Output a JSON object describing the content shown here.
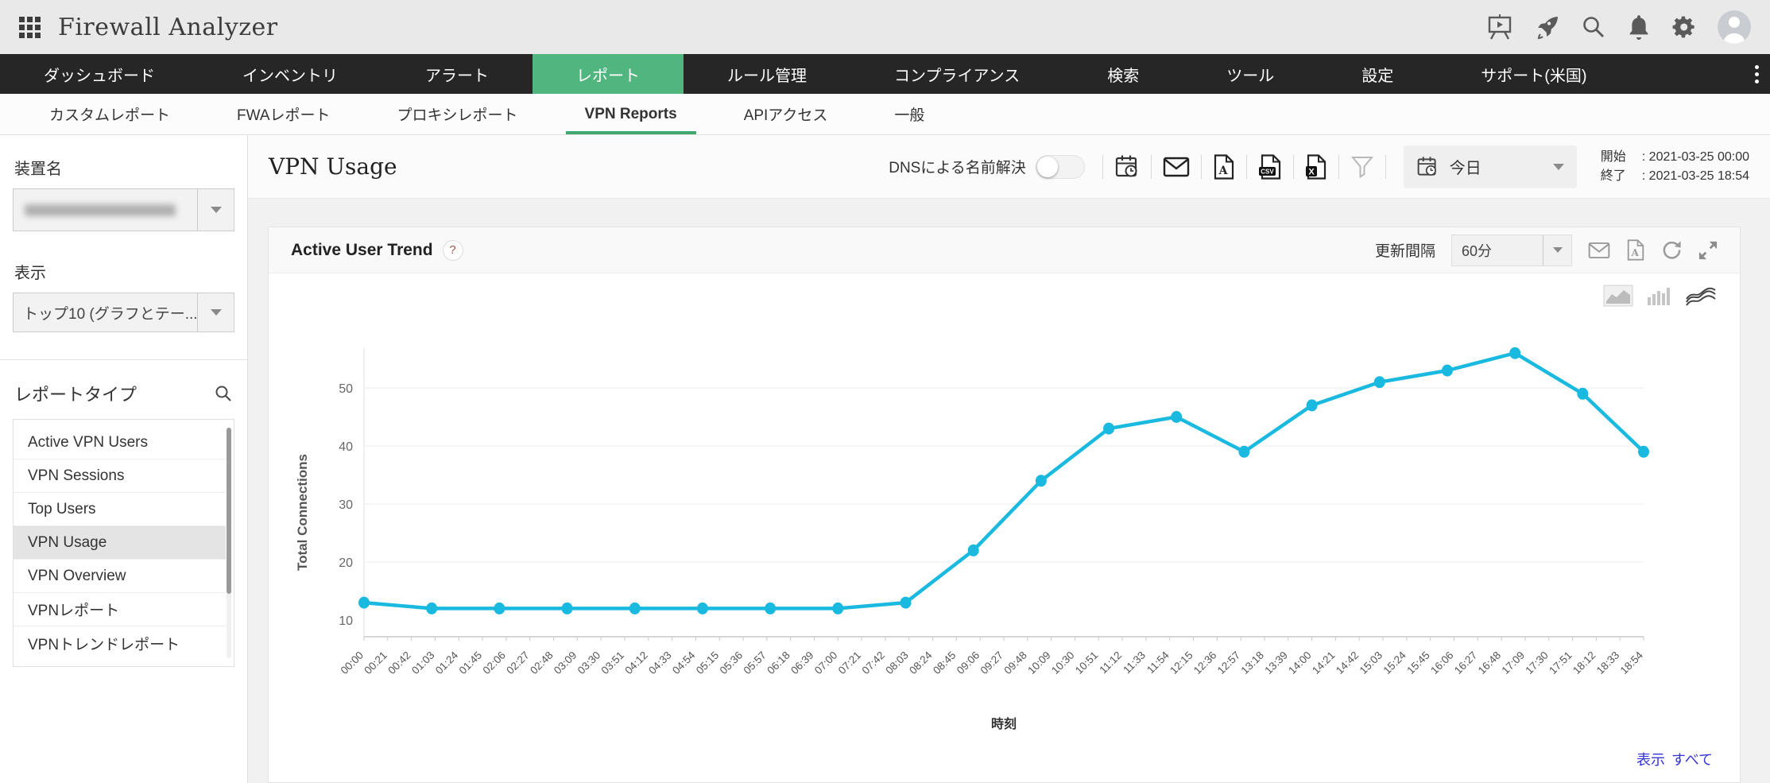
{
  "colors": {
    "accent_green": "#50b57e",
    "active_tab_underline": "#3ea86f",
    "nav_bg": "#262626",
    "line_cyan": "#1ab9e0",
    "link_blue": "#3434d6",
    "selected_row_bg": "#e4e4e4"
  },
  "header": {
    "title": "Firewall Analyzer",
    "icons": [
      "apps-grid-icon",
      "presentation-icon",
      "rocket-icon",
      "search-icon",
      "bell-icon",
      "gear-icon",
      "avatar"
    ]
  },
  "nav": {
    "items": [
      {
        "id": "dashboard",
        "label": "ダッシュボード",
        "active": false
      },
      {
        "id": "inventory",
        "label": "インベントリ",
        "active": false
      },
      {
        "id": "alerts",
        "label": "アラート",
        "active": false
      },
      {
        "id": "reports",
        "label": "レポート",
        "active": true
      },
      {
        "id": "rule-management",
        "label": "ルール管理",
        "active": false
      },
      {
        "id": "compliance",
        "label": "コンプライアンス",
        "active": false
      },
      {
        "id": "search",
        "label": "検索",
        "active": false
      },
      {
        "id": "tools",
        "label": "ツール",
        "active": false
      },
      {
        "id": "settings",
        "label": "設定",
        "active": false
      },
      {
        "id": "support-us",
        "label": "サポート(米国)",
        "active": false
      }
    ],
    "overflow_icon": "kebab-menu-icon"
  },
  "subnav": {
    "items": [
      {
        "id": "custom-reports",
        "label": "カスタムレポート",
        "active": false
      },
      {
        "id": "fwa-reports",
        "label": "FWAレポート",
        "active": false
      },
      {
        "id": "proxy-reports",
        "label": "プロキシレポート",
        "active": false
      },
      {
        "id": "vpn-reports",
        "label": "VPN Reports",
        "active": true
      },
      {
        "id": "api-access",
        "label": "APIアクセス",
        "active": false
      },
      {
        "id": "general",
        "label": "一般",
        "active": false
      }
    ]
  },
  "sidebar": {
    "device_label": "装置名",
    "device_value_redacted": true,
    "display_label": "表示",
    "display_value": "トップ10 (グラフとテー...",
    "report_type_label": "レポートタイプ",
    "report_type_search_icon": "search-icon",
    "report_types": [
      {
        "id": "active-vpn-users",
        "label": "Active VPN Users",
        "selected": false
      },
      {
        "id": "vpn-sessions",
        "label": "VPN Sessions",
        "selected": false
      },
      {
        "id": "top-users",
        "label": "Top Users",
        "selected": false
      },
      {
        "id": "vpn-usage",
        "label": "VPN Usage",
        "selected": true
      },
      {
        "id": "vpn-overview",
        "label": "VPN Overview",
        "selected": false
      },
      {
        "id": "vpn-report",
        "label": "VPNレポート",
        "selected": false
      },
      {
        "id": "vpn-trend-report",
        "label": "VPNトレンドレポート",
        "selected": false
      }
    ]
  },
  "page": {
    "title": "VPN Usage",
    "dns_label": "DNSによる名前解決",
    "dns_toggle_state": "off",
    "toolbar_icons": [
      "schedule-icon",
      "mail-icon",
      "pdf-icon",
      "csv-icon",
      "excel-icon",
      "filter-icon"
    ],
    "period": {
      "icon": "calendar-clock-icon",
      "value": "今日"
    },
    "range": {
      "start_label": "開始",
      "start_value": ": 2021-03-25 00:00",
      "end_label": "終了",
      "end_value": ": 2021-03-25 18:54"
    }
  },
  "card": {
    "title": "Active User Trend",
    "help_badge": "?",
    "refresh_label": "更新間隔",
    "refresh_value": "60分",
    "header_icons": [
      "mail-icon",
      "pdf-icon",
      "refresh-icon",
      "expand-icon"
    ],
    "chart_type_icons": [
      "area-chart-icon",
      "bar-chart-icon",
      "line-chart-icon"
    ],
    "footer": {
      "label": "表示",
      "value": "すべて"
    }
  },
  "chart_data": {
    "type": "line",
    "title": "Active User Trend",
    "xlabel": "時刻",
    "ylabel": "Total Connections",
    "ylim": [
      10,
      57
    ],
    "yticks": [
      10,
      20,
      30,
      40,
      50
    ],
    "grid": true,
    "legend": false,
    "line_color": "#1ab9e0",
    "x_axis": {
      "start": "00:00",
      "end": "18:54",
      "tick_interval_minutes": 21
    },
    "points": [
      {
        "t": "00:00",
        "v": 13
      },
      {
        "t": "01:00",
        "v": 12
      },
      {
        "t": "02:00",
        "v": 12
      },
      {
        "t": "03:00",
        "v": 12
      },
      {
        "t": "04:00",
        "v": 12
      },
      {
        "t": "05:00",
        "v": 12
      },
      {
        "t": "06:00",
        "v": 12
      },
      {
        "t": "07:00",
        "v": 12
      },
      {
        "t": "08:00",
        "v": 13
      },
      {
        "t": "09:00",
        "v": 22
      },
      {
        "t": "10:00",
        "v": 34
      },
      {
        "t": "11:00",
        "v": 43
      },
      {
        "t": "12:00",
        "v": 45
      },
      {
        "t": "13:00",
        "v": 39
      },
      {
        "t": "14:00",
        "v": 47
      },
      {
        "t": "15:00",
        "v": 51
      },
      {
        "t": "16:00",
        "v": 53
      },
      {
        "t": "17:00",
        "v": 56
      },
      {
        "t": "18:00",
        "v": 49
      },
      {
        "t": "18:54",
        "v": 39
      }
    ]
  }
}
